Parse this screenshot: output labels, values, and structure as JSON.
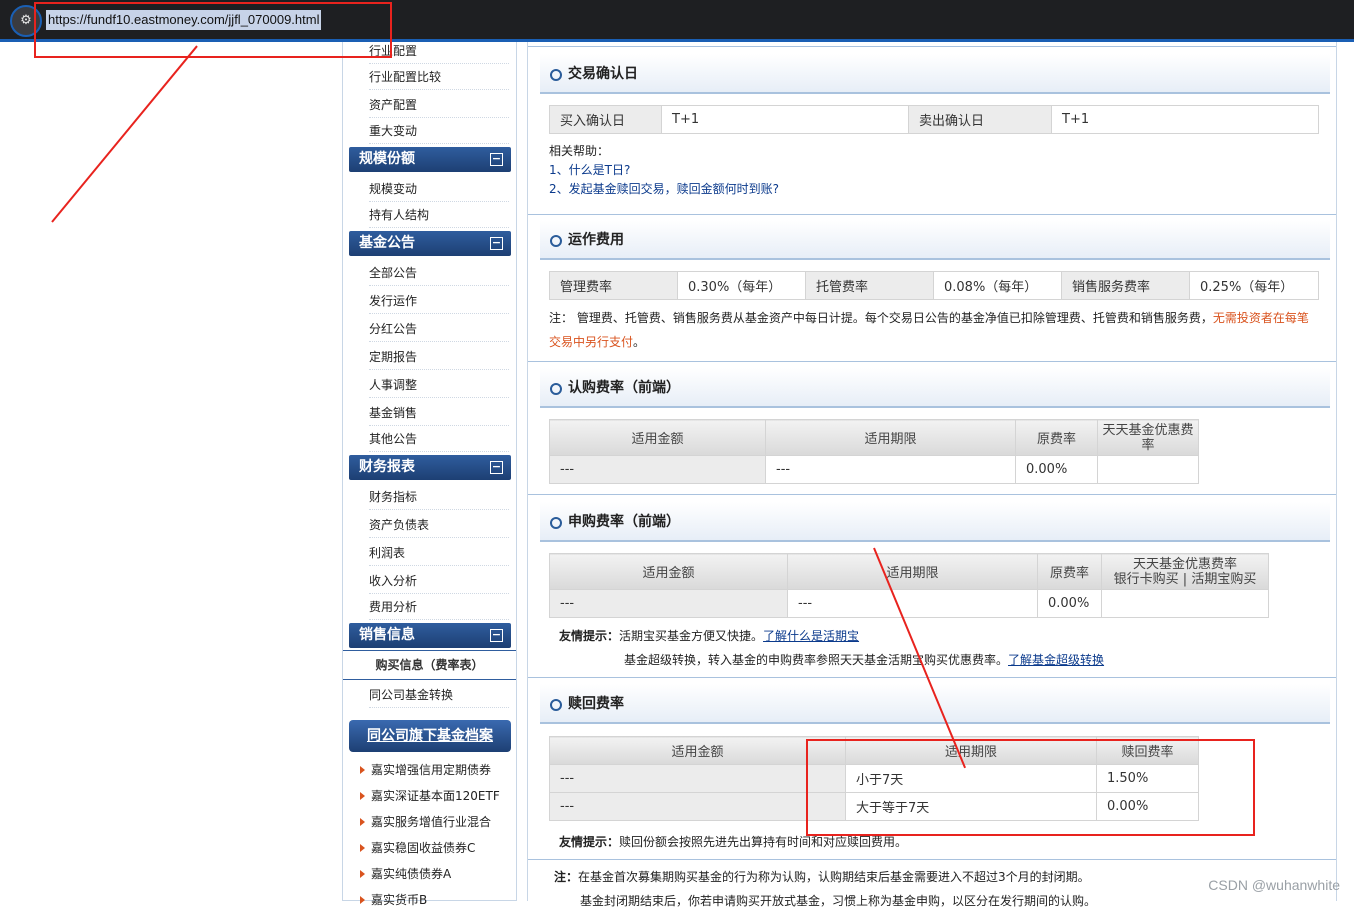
{
  "browser": {
    "url": "https://fundf10.eastmoney.com/jjfl_070009.html",
    "site_icon": "site-settings-icon"
  },
  "sidebar": {
    "items_top": [
      "行业配置",
      "行业配置比较",
      "资产配置",
      "重大变动"
    ],
    "group_scale": {
      "title": "规模份额",
      "items": [
        "规模变动",
        "持有人结构"
      ]
    },
    "group_notice": {
      "title": "基金公告",
      "items": [
        "全部公告",
        "发行运作",
        "分红公告",
        "定期报告",
        "人事调整",
        "基金销售",
        "其他公告"
      ]
    },
    "group_finance": {
      "title": "财务报表",
      "items": [
        "财务指标",
        "资产负债表",
        "利润表",
        "收入分析",
        "费用分析"
      ]
    },
    "group_sales": {
      "title": "销售信息",
      "active": "购买信息（费率表）",
      "items": [
        "同公司基金转换"
      ]
    },
    "related": {
      "title": "同公司旗下基金档案",
      "items": [
        "嘉实增强信用定期债券",
        "嘉实深证基本面120ETF",
        "嘉实服务增值行业混合",
        "嘉实稳固收益债券C",
        "嘉实纯债债券A",
        "嘉实货币B"
      ]
    }
  },
  "confirm": {
    "title": "交易确认日",
    "buy_label": "买入确认日",
    "buy_value": "T+1",
    "sell_label": "卖出确认日",
    "sell_value": "T+1",
    "help_label": "相关帮助：",
    "help_1": "1、什么是T日?",
    "help_2": "2、发起基金赎回交易，赎回金额何时到账?"
  },
  "operating": {
    "title": "运作费用",
    "mgmt_label": "管理费率",
    "mgmt_value": "0.30%（每年）",
    "custody_label": "托管费率",
    "custody_value": "0.08%（每年）",
    "service_label": "销售服务费率",
    "service_value": "0.25%（每年）",
    "note_prefix": "注：",
    "note_body": "管理费、托管费、销售服务费从基金资产中每日计提。每个交易日公告的基金净值已扣除管理费、托管费和销售服务费，",
    "note_red": "无需投资者在每笔交易中另行支付",
    "note_end": "。"
  },
  "subscribe": {
    "title": "认购费率（前端）",
    "headers": [
      "适用金额",
      "适用期限",
      "原费率",
      "天天基金优惠费率"
    ],
    "row": [
      "---",
      "---",
      "0.00%",
      ""
    ]
  },
  "purchase": {
    "title": "申购费率（前端）",
    "headers": [
      "适用金额",
      "适用期限",
      "原费率",
      "天天基金优惠费率",
      "银行卡购买",
      "活期宝购买"
    ],
    "row": [
      "---",
      "---",
      "0.00%",
      ""
    ],
    "tip_label": "友情提示：",
    "tip_1": "活期宝买基金方便又快捷。",
    "tip_1_link": "了解什么是活期宝",
    "tip_2": "基金超级转换，转入基金的申购费率参照天天基金活期宝购买优惠费率。",
    "tip_2_link": "了解基金超级转换"
  },
  "redeem": {
    "title": "赎回费率",
    "headers": [
      "适用金额",
      "适用期限",
      "赎回费率"
    ],
    "rows": [
      [
        "---",
        "小于7天",
        "1.50%"
      ],
      [
        "---",
        "大于等于7天",
        "0.00%"
      ]
    ],
    "tip_label": "友情提示：",
    "tip": "赎回份额会按照先进先出算持有时间和对应赎回费用。"
  },
  "footer_note": {
    "prefix": "注：",
    "line1": "在基金首次募集期购买基金的行为称为认购，认购期结束后基金需要进入不超过3个月的封闭期。",
    "line2": "基金封闭期结束后，你若申请购买开放式基金，习惯上称为基金申购，以区分在发行期间的认购。"
  },
  "watermark": "CSDN @wuhanwhite",
  "annotation_color": "#e8231e"
}
